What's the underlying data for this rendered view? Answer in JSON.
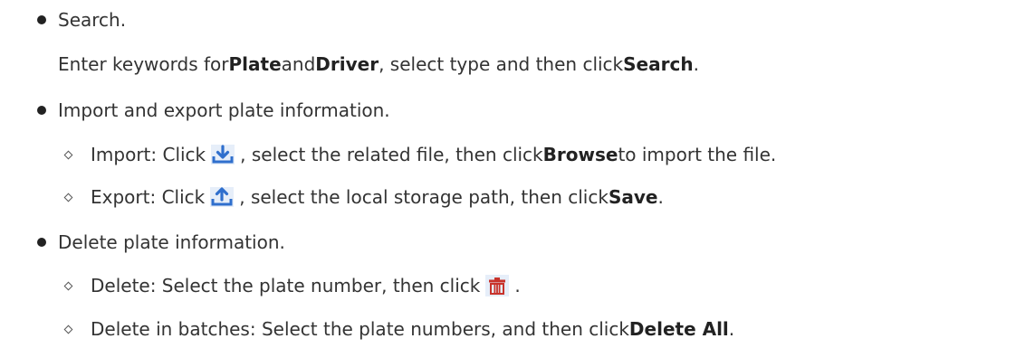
{
  "items": {
    "search": {
      "title": "Search.",
      "desc": {
        "pre": "Enter keywords for ",
        "plate": "Plate",
        "and": " and ",
        "driver": "Driver",
        "mid": ", select type and then click ",
        "search": "Search",
        "end": "."
      }
    },
    "import_export": {
      "title": "Import and export plate information.",
      "import": {
        "pre": "Import: Click",
        "mid": ", select the related file, then click ",
        "browse": "Browse",
        "end": " to import the file.",
        "icon": "download-icon"
      },
      "export": {
        "pre": "Export: Click",
        "mid": ", select the local storage path, then click ",
        "save": "Save",
        "end": ".",
        "icon": "upload-icon"
      }
    },
    "delete": {
      "title": "Delete plate information.",
      "single": {
        "pre": "Delete: Select the plate number, then click",
        "end": ".",
        "icon": "trash-icon"
      },
      "batch": {
        "pre": "Delete in batches: Select the plate numbers, and then click ",
        "delete_all": "Delete All",
        "end": "."
      }
    }
  },
  "colors": {
    "icon_blue": "#2f6fcd",
    "icon_bg": "#e6eef9",
    "trash_red": "#c8332b"
  }
}
